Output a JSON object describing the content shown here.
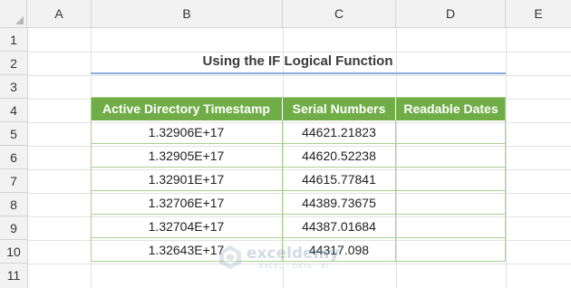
{
  "columns": [
    "A",
    "B",
    "C",
    "D",
    "E"
  ],
  "rows": [
    "1",
    "2",
    "3",
    "4",
    "5",
    "6",
    "7",
    "8",
    "9",
    "10",
    "11"
  ],
  "title": "Using the IF Logical Function",
  "table": {
    "headers": [
      "Active Directory Timestamp",
      "Serial Numbers",
      "Readable Dates"
    ],
    "rows": [
      [
        "1.32906E+17",
        "44621.21823",
        ""
      ],
      [
        "1.32905E+17",
        "44620.52238",
        ""
      ],
      [
        "1.32901E+17",
        "44615.77841",
        ""
      ],
      [
        "1.32706E+17",
        "44389.73675",
        ""
      ],
      [
        "1.32704E+17",
        "44387.01684",
        ""
      ],
      [
        "1.32643E+17",
        "44317.098",
        ""
      ]
    ]
  },
  "watermark": {
    "name": "exceldemy",
    "tagline": "EXCEL · DATA · BI"
  },
  "colors": {
    "header_green": "#70ad47",
    "border_green": "#a9d08e",
    "title_underline": "#8eaadb"
  }
}
